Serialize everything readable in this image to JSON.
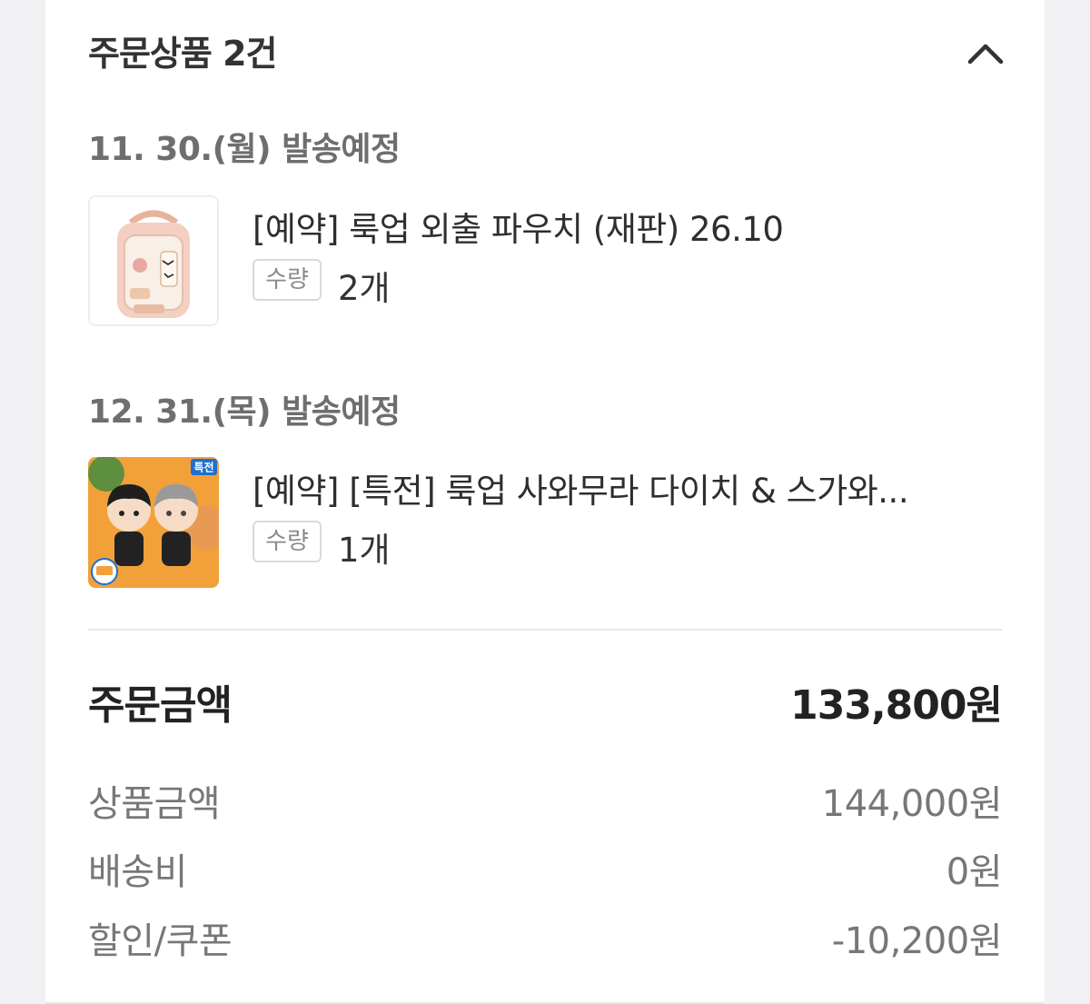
{
  "order_items": {
    "title": "주문상품 2건",
    "collapse_icon": "chevron-up-icon",
    "groups": [
      {
        "ship_date": "11. 30.(월) 발송예정",
        "product_name": "[예약] 룩업 외출 파우치 (재판) 26.10",
        "qty_label": "수량",
        "qty_value": "2개",
        "thumbnail": "pink-pouch-image"
      },
      {
        "ship_date": "12. 31.(목) 발송예정",
        "product_name": "[예약] [특전] 룩업 사와무라 다이치 & 스가와...",
        "qty_label": "수량",
        "qty_value": "1개",
        "thumbnail": "figures-image",
        "badge": "특전"
      }
    ]
  },
  "summary": {
    "total_label": "주문금액",
    "total_value": "133,800원",
    "rows": [
      {
        "label": "상품금액",
        "value": "144,000원"
      },
      {
        "label": "배송비",
        "value": "0원"
      },
      {
        "label": "할인/쿠폰",
        "value": "-10,200원"
      }
    ]
  },
  "colors": {
    "background": "#f1f1f3",
    "card": "#ffffff",
    "text_primary": "#222222",
    "text_secondary": "#777777",
    "thumb2_bg": "#f2a13a"
  }
}
